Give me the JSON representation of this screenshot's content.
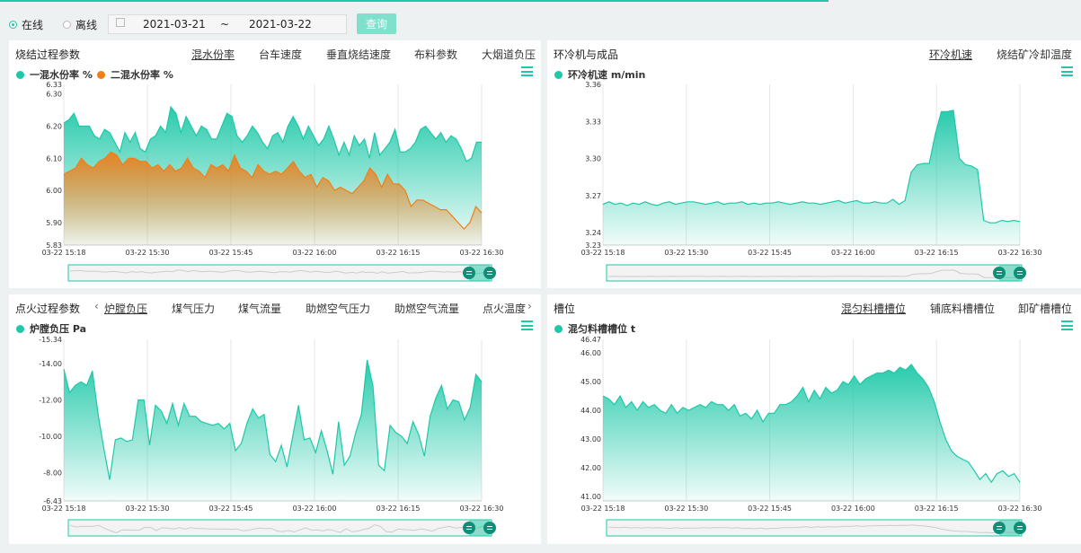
{
  "toolbar": {
    "online_label": "在线",
    "offline_label": "离线",
    "date_start": "2021-03-21",
    "date_sep": "~",
    "date_end": "2021-03-22",
    "query_label": "查询"
  },
  "colors": {
    "accent": "#1ec8a8",
    "orange": "#f07f1a"
  },
  "panels": [
    {
      "title": "烧结过程参数",
      "tabs": [
        {
          "label": "混水份率",
          "active": true
        },
        {
          "label": "台车速度",
          "active": false
        },
        {
          "label": "垂直烧结速度",
          "active": false
        },
        {
          "label": "布料参数",
          "active": false
        },
        {
          "label": "大烟道负压",
          "active": false
        }
      ],
      "legend": [
        {
          "label": "一混水份率 %",
          "color": "#1ec8a8"
        },
        {
          "label": "二混水份率 %",
          "color": "#f07f1a"
        }
      ]
    },
    {
      "title": "环冷机与成品",
      "tabs": [
        {
          "label": "环冷机速",
          "active": true
        },
        {
          "label": "烧结矿冷却温度",
          "active": false
        }
      ],
      "legend": [
        {
          "label": "环冷机速 m/min",
          "color": "#1ec8a8"
        }
      ]
    },
    {
      "title": "点火过程参数",
      "tabs": [
        {
          "label": "炉膛负压",
          "active": true
        },
        {
          "label": "煤气压力",
          "active": false
        },
        {
          "label": "煤气流量",
          "active": false
        },
        {
          "label": "助燃空气压力",
          "active": false
        },
        {
          "label": "助燃空气流量",
          "active": false
        },
        {
          "label": "点火温度",
          "active": false
        }
      ],
      "legend": [
        {
          "label": "炉膛负压 Pa",
          "color": "#1ec8a8"
        }
      ]
    },
    {
      "title": "槽位",
      "tabs": [
        {
          "label": "混匀料槽槽位",
          "active": true
        },
        {
          "label": "铺底料槽槽位",
          "active": false
        },
        {
          "label": "卸矿槽槽位",
          "active": false
        }
      ],
      "legend": [
        {
          "label": "混匀料槽槽位 t",
          "color": "#1ec8a8"
        }
      ]
    }
  ],
  "chart_data": [
    {
      "type": "area",
      "x_labels": [
        "03-22 15:18",
        "03-22 15:30",
        "03-22 15:45",
        "03-22 16:00",
        "03-22 16:15",
        "03-22 16:30"
      ],
      "y_labels": [
        "6.33",
        "6.30",
        "6.20",
        "6.10",
        "6.00",
        "5.90",
        "5.83"
      ],
      "ylim": [
        5.83,
        6.33
      ],
      "grid": "vertical",
      "series": [
        {
          "name": "一混水份率 %",
          "color": "#1ec8a8",
          "values": [
            6.21,
            6.22,
            6.24,
            6.2,
            6.2,
            6.2,
            6.17,
            6.16,
            6.19,
            6.18,
            6.15,
            6.12,
            6.18,
            6.15,
            6.18,
            6.13,
            6.12,
            6.16,
            6.17,
            6.2,
            6.18,
            6.26,
            6.24,
            6.18,
            6.23,
            6.2,
            6.17,
            6.2,
            6.19,
            6.16,
            6.16,
            6.2,
            6.24,
            6.23,
            6.17,
            6.15,
            6.17,
            6.2,
            6.18,
            6.15,
            6.13,
            6.17,
            6.18,
            6.15,
            6.2,
            6.23,
            6.2,
            6.16,
            6.2,
            6.17,
            6.14,
            6.16,
            6.2,
            6.16,
            6.11,
            6.15,
            6.11,
            6.17,
            6.14,
            6.16,
            6.1,
            6.18,
            6.11,
            6.13,
            6.15,
            6.19,
            6.12,
            6.12,
            6.13,
            6.15,
            6.19,
            6.2,
            6.18,
            6.16,
            6.18,
            6.15,
            6.17,
            6.16,
            6.13,
            6.09,
            6.1,
            6.15,
            6.15
          ]
        },
        {
          "name": "二混水份率 %",
          "color": "#f07f1a",
          "values": [
            6.05,
            6.06,
            6.07,
            6.1,
            6.08,
            6.07,
            6.09,
            6.1,
            6.12,
            6.11,
            6.08,
            6.1,
            6.1,
            6.09,
            6.09,
            6.07,
            6.08,
            6.06,
            6.08,
            6.06,
            6.07,
            6.1,
            6.07,
            6.06,
            6.04,
            6.08,
            6.07,
            6.08,
            6.06,
            6.11,
            6.07,
            6.06,
            6.04,
            6.08,
            6.06,
            6.05,
            6.06,
            6.05,
            6.07,
            6.09,
            6.06,
            6.04,
            6.05,
            6.01,
            6.04,
            6.03,
            6.0,
            6.01,
            6.0,
            5.99,
            6.01,
            6.03,
            6.07,
            6.05,
            6.01,
            6.05,
            6.02,
            6.02,
            6.0,
            5.95,
            5.97,
            5.97,
            5.96,
            5.95,
            5.94,
            5.94,
            5.92,
            5.9,
            5.88,
            5.9,
            5.95,
            5.93
          ]
        }
      ]
    },
    {
      "type": "area",
      "x_labels": [
        "03-22 15:18",
        "03-22 15:30",
        "03-22 15:45",
        "03-22 16:00",
        "03-22 16:15",
        "03-22 16:30"
      ],
      "y_labels": [
        "3.36",
        "3.33",
        "3.30",
        "3.27",
        "3.24",
        "3.23"
      ],
      "ylim": [
        3.23,
        3.36
      ],
      "grid": "vertical",
      "series": [
        {
          "name": "环冷机速 m/min",
          "color": "#1ec8a8",
          "values": [
            3.263,
            3.265,
            3.263,
            3.264,
            3.262,
            3.264,
            3.263,
            3.265,
            3.263,
            3.262,
            3.264,
            3.265,
            3.263,
            3.264,
            3.265,
            3.265,
            3.264,
            3.263,
            3.264,
            3.265,
            3.263,
            3.264,
            3.264,
            3.265,
            3.263,
            3.264,
            3.263,
            3.264,
            3.264,
            3.265,
            3.264,
            3.263,
            3.264,
            3.265,
            3.264,
            3.264,
            3.263,
            3.264,
            3.265,
            3.266,
            3.264,
            3.265,
            3.266,
            3.264,
            3.264,
            3.265,
            3.264,
            3.264,
            3.267,
            3.263,
            3.266,
            3.289,
            3.295,
            3.296,
            3.296,
            3.32,
            3.338,
            3.338,
            3.339,
            3.3,
            3.295,
            3.294,
            3.291,
            3.25,
            3.248,
            3.248,
            3.25,
            3.249,
            3.25,
            3.249
          ]
        }
      ]
    },
    {
      "type": "area",
      "x_labels": [
        "03-22 15:18",
        "03-22 15:30",
        "03-22 15:45",
        "03-22 16:00",
        "03-22 16:15",
        "03-22 16:30"
      ],
      "y_labels": [
        "-15.34",
        "-14.00",
        "-12.00",
        "-10.00",
        "-8.00",
        "-6.43"
      ],
      "ylim": [
        -15.34,
        -6.43
      ],
      "reverse_fill": true,
      "grid": "vertical",
      "series": [
        {
          "name": "炉膛负压 Pa",
          "color": "#1ec8a8",
          "values": [
            -13.7,
            -12.4,
            -12.8,
            -13.0,
            -12.8,
            -13.6,
            -11.2,
            -9.3,
            -7.6,
            -9.8,
            -9.9,
            -9.7,
            -9.8,
            -12.0,
            -12.0,
            -9.5,
            -11.7,
            -11.4,
            -10.7,
            -11.8,
            -10.6,
            -11.8,
            -11.1,
            -11.1,
            -10.8,
            -10.7,
            -10.6,
            -10.7,
            -10.4,
            -10.7,
            -9.2,
            -9.6,
            -10.7,
            -11.5,
            -11.0,
            -11.2,
            -9.0,
            -8.6,
            -9.5,
            -8.3,
            -10.0,
            -11.7,
            -9.8,
            -9.9,
            -9.1,
            -10.3,
            -9.2,
            -7.9,
            -10.8,
            -8.4,
            -8.9,
            -10.2,
            -11.2,
            -14.2,
            -12.8,
            -8.4,
            -8.1,
            -10.6,
            -10.2,
            -10.0,
            -9.6,
            -10.8,
            -10.1,
            -8.9,
            -11.1,
            -12.1,
            -12.8,
            -11.5,
            -12.0,
            -11.9,
            -10.9,
            -11.6,
            -13.4,
            -13.0
          ]
        }
      ]
    },
    {
      "type": "area",
      "x_labels": [
        "03-22 15:18",
        "03-22 15:30",
        "03-22 15:45",
        "03-22 16:00",
        "03-22 16:15",
        "03-22 16:30"
      ],
      "y_labels": [
        "46.47",
        "46.00",
        "45.00",
        "44.00",
        "43.00",
        "42.00",
        "41.00"
      ],
      "ylim": [
        40.85,
        46.47
      ],
      "grid": "vertical",
      "series": [
        {
          "name": "混匀料槽槽位 t",
          "color": "#1ec8a8",
          "values": [
            44.5,
            44.4,
            44.2,
            44.5,
            44.1,
            44.3,
            44.0,
            44.3,
            44.1,
            44.2,
            44.0,
            43.9,
            44.2,
            43.9,
            44.1,
            44.0,
            44.1,
            44.2,
            44.1,
            44.3,
            44.2,
            44.2,
            44.0,
            44.2,
            43.8,
            43.9,
            43.7,
            44.0,
            43.6,
            43.9,
            43.9,
            44.2,
            44.2,
            44.3,
            44.5,
            44.8,
            44.3,
            44.7,
            44.4,
            44.8,
            44.6,
            44.7,
            45.0,
            44.9,
            45.2,
            44.9,
            45.1,
            45.2,
            45.3,
            45.3,
            45.4,
            45.3,
            45.5,
            45.4,
            45.6,
            45.3,
            45.1,
            44.8,
            44.3,
            43.6,
            43.0,
            42.6,
            42.4,
            42.3,
            42.2,
            41.9,
            41.6,
            41.8,
            41.5,
            41.8,
            41.9,
            41.7,
            41.8,
            41.5
          ]
        }
      ]
    }
  ]
}
